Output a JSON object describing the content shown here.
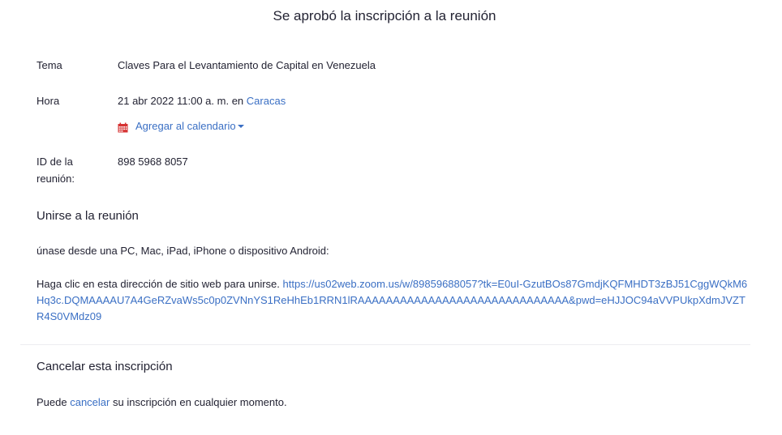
{
  "header": {
    "title": "Se aprobó la inscripción a la reunión"
  },
  "details": {
    "topic_label": "Tema",
    "topic_value": "Claves Para el Levantamiento de Capital en Venezuela",
    "time_label": "Hora",
    "time_value": "21 abr 2022 11:00 a. m. en",
    "time_zone": "Caracas",
    "calendar_label": "Agregar al calendario",
    "meeting_id_label": "ID de la reunión:",
    "meeting_id_value": "898 5968 8057"
  },
  "join": {
    "heading": "Unirse a la reunión",
    "devices_text": "únase desde una PC, Mac, iPad, iPhone o dispositivo Android:",
    "click_text": "Haga clic en esta dirección de sitio web para unirse.",
    "url": "https://us02web.zoom.us/w/89859688057?tk=E0uI-GzutBOs87GmdjKQFMHDT3zBJ51CggWQkM6Hq3c.DQMAAAAU7A4GeRZvaWs5c0p0ZVNnYS1ReHhEb1RRN1lRAAAAAAAAAAAAAAAAAAAAAAAAAAAAAA&pwd=eHJJOC94aVVPUkpXdmJVZTR4S0VMdz09"
  },
  "cancel": {
    "heading": "Cancelar esta inscripción",
    "text_before": "Puede",
    "link": "cancelar",
    "text_after": "su inscripción en cualquier momento."
  },
  "colors": {
    "link": "#3a6fc4",
    "calendar_icon": "#d63333",
    "text": "#232333"
  }
}
